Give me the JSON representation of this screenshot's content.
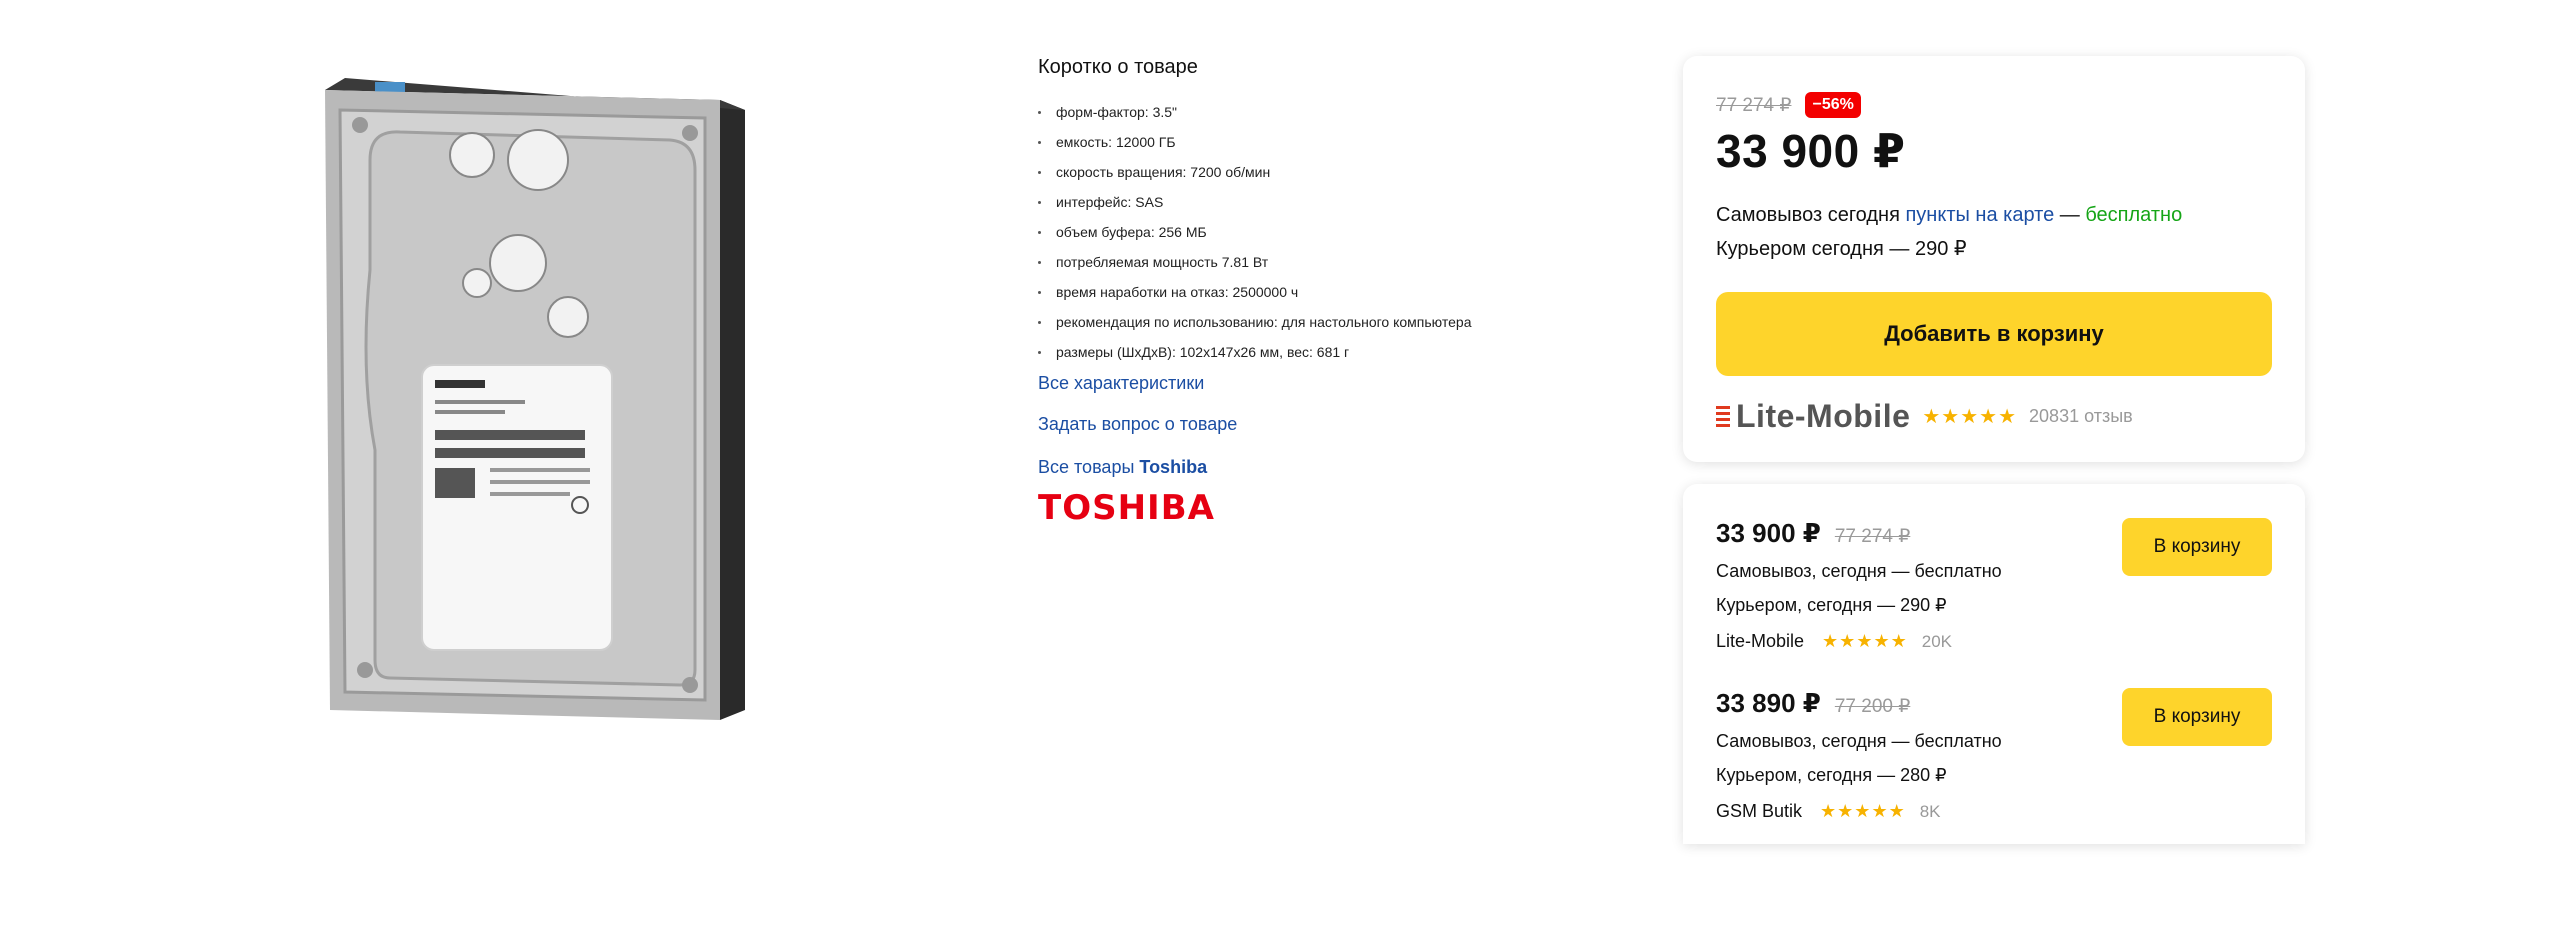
{
  "product": {
    "image_alt": "Toshiba hard drive"
  },
  "info": {
    "heading": "Коротко о товаре",
    "specs": [
      "форм-фактор: 3.5\"",
      "емкость: 12000 ГБ",
      "скорость вращения: 7200 об/мин",
      "интерфейс: SAS",
      "объем буфера: 256 МБ",
      "потребляемая мощность 7.81 Вт",
      "время наработки на отказ: 2500000 ч",
      "рекомендация по использованию: для настольного компьютера",
      "размеры (ШхДхВ): 102x147x26 мм, вес: 681 г"
    ],
    "all_specs_link": "Все характеристики",
    "ask_link": "Задать вопрос о товаре",
    "brand_link_prefix": "Все товары",
    "brand_link_name": "Toshiba",
    "brand_logo": "TOSHIBA"
  },
  "buybox": {
    "old_price": "77 274 ₽",
    "discount": "−56%",
    "price": "33 900 ₽",
    "pickup_prefix": "Самовывоз сегодня",
    "pickup_link": "пункты на карте",
    "pickup_dash": "—",
    "pickup_free": "бесплатно",
    "courier": "Курьером сегодня — 290 ₽",
    "add_to_cart": "Добавить в корзину",
    "seller_name": "Lite-Mobile",
    "stars": "★★★★★",
    "reviews": "20831 отзыв"
  },
  "offers": [
    {
      "price": "33 900 ₽",
      "old_price": "77 274 ₽",
      "pickup": "Самовывоз, сегодня — бесплатно",
      "courier": "Курьером, сегодня — 290 ₽",
      "seller": "Lite-Mobile",
      "stars": "★★★★★",
      "count": "20K",
      "button": "В корзину"
    },
    {
      "price": "33 890 ₽",
      "old_price": "77 200 ₽",
      "pickup": "Самовывоз, сегодня — бесплатно",
      "courier": "Курьером, сегодня — 280 ₽",
      "seller": "GSM Butik",
      "stars": "★★★★★",
      "count": "8K",
      "button": "В корзину"
    }
  ],
  "colors": {
    "accent_yellow": "#fed42b",
    "link_blue": "#1b4ea3",
    "discount_red": "#f30000",
    "free_green": "#16a517",
    "brand_red": "#e60012",
    "star": "#f7b200"
  }
}
